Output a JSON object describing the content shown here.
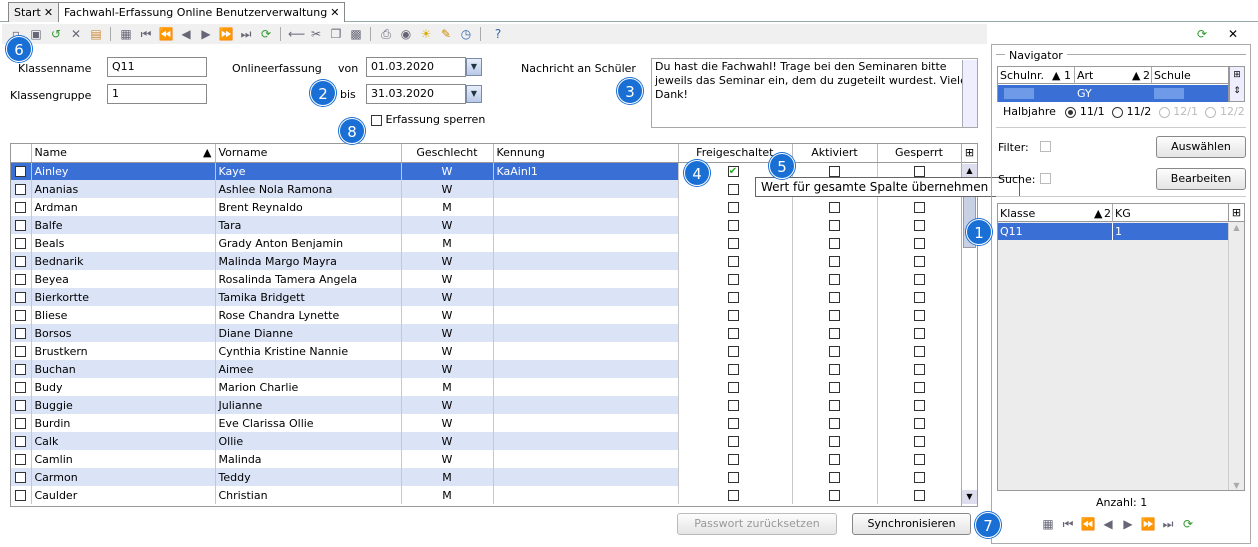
{
  "tabs": [
    {
      "label": "Start"
    },
    {
      "label": "Fachwahl-Erfassung Online Benutzerverwaltung"
    }
  ],
  "form": {
    "klassenname_label": "Klassenname",
    "klassenname_value": "Q11",
    "klassengruppe_label": "Klassengruppe",
    "klassengruppe_value": "1",
    "onlineerfassung_label": "Onlineerfassung",
    "von_label": "von",
    "von_value": "01.03.2020",
    "bis_label": "bis",
    "bis_value": "31.03.2020",
    "sperren_label": "Erfassung sperren",
    "nachricht_label": "Nachricht an Schüler",
    "nachricht_text": "Du hast die Fachwahl! Trage bei den Seminaren bitte jeweils das Seminar ein, dem du zugeteilt wurdest. Vielen Dank!"
  },
  "table": {
    "headers": {
      "name": "Name",
      "vorname": "Vorname",
      "geschlecht": "Geschlecht",
      "kennung": "Kennung",
      "freigeschaltet": "Freigeschaltet",
      "aktiviert": "Aktiviert",
      "gesperrt": "Gesperrt"
    },
    "rows": [
      {
        "name": "Ainley",
        "vorname": "Kaye",
        "g": "W",
        "kennung": "KaAinl1",
        "frei": true
      },
      {
        "name": "Ananias",
        "vorname": "Ashlee Nola Ramona",
        "g": "W",
        "kennung": "",
        "frei": false
      },
      {
        "name": "Ardman",
        "vorname": "Brent Reynaldo",
        "g": "M",
        "kennung": "",
        "frei": false
      },
      {
        "name": "Balfe",
        "vorname": "Tara",
        "g": "W",
        "kennung": "",
        "frei": false
      },
      {
        "name": "Beals",
        "vorname": "Grady Anton Benjamin",
        "g": "M",
        "kennung": "",
        "frei": false
      },
      {
        "name": "Bednarik",
        "vorname": "Malinda Margo Mayra",
        "g": "W",
        "kennung": "",
        "frei": false
      },
      {
        "name": "Beyea",
        "vorname": "Rosalinda Tamera Angela",
        "g": "W",
        "kennung": "",
        "frei": false
      },
      {
        "name": "Bierkortte",
        "vorname": "Tamika Bridgett",
        "g": "W",
        "kennung": "",
        "frei": false
      },
      {
        "name": "Bliese",
        "vorname": "Rose Chandra Lynette",
        "g": "W",
        "kennung": "",
        "frei": false
      },
      {
        "name": "Borsos",
        "vorname": "Diane Dianne",
        "g": "W",
        "kennung": "",
        "frei": false
      },
      {
        "name": "Brustkern",
        "vorname": "Cynthia Kristine Nannie",
        "g": "W",
        "kennung": "",
        "frei": false
      },
      {
        "name": "Buchan",
        "vorname": "Aimee",
        "g": "W",
        "kennung": "",
        "frei": false
      },
      {
        "name": "Budy",
        "vorname": "Marion Charlie",
        "g": "M",
        "kennung": "",
        "frei": false
      },
      {
        "name": "Buggie",
        "vorname": "Julianne",
        "g": "W",
        "kennung": "",
        "frei": false
      },
      {
        "name": "Burdin",
        "vorname": "Eve Clarissa Ollie",
        "g": "W",
        "kennung": "",
        "frei": false
      },
      {
        "name": "Calk",
        "vorname": "Ollie",
        "g": "W",
        "kennung": "",
        "frei": false
      },
      {
        "name": "Camlin",
        "vorname": "Malinda",
        "g": "W",
        "kennung": "",
        "frei": false
      },
      {
        "name": "Carmon",
        "vorname": "Teddy",
        "g": "M",
        "kennung": "",
        "frei": false
      },
      {
        "name": "Caulder",
        "vorname": "Christian",
        "g": "M",
        "kennung": "",
        "frei": false
      }
    ]
  },
  "tooltip": "Wert für gesamte Spalte übernehmen",
  "buttons": {
    "passwort": "Passwort zurücksetzen",
    "sync": "Synchronisieren"
  },
  "navigator": {
    "title": "Navigator",
    "schule_headers": {
      "schulnr": "Schulnr.",
      "schulnr_sort": "1",
      "art": "Art",
      "art_sort": "2",
      "schule": "Schule"
    },
    "schule_row": {
      "art": "GY"
    },
    "halbjahre_label": "Halbjahre",
    "halbjahre": [
      "11/1",
      "11/2",
      "12/1",
      "12/2"
    ],
    "filter_label": "Filter:",
    "filter_btn": "Auswählen",
    "suche_label": "Suche:",
    "suche_btn": "Bearbeiten",
    "klasse_headers": {
      "klasse": "Klasse",
      "klasse_sort": "2",
      "kg": "KG"
    },
    "klasse_row": {
      "klasse": "Q11",
      "kg": "1"
    },
    "anzahl": "Anzahl: 1"
  },
  "badges": {
    "b1": "1",
    "b2": "2",
    "b3": "3",
    "b4": "4",
    "b5": "5",
    "b6": "6",
    "b7": "7",
    "b8": "8"
  },
  "colors": {
    "accent": "#1a6fd4",
    "selection": "#3a6fd6",
    "alt_row": "#dbe4f7"
  }
}
